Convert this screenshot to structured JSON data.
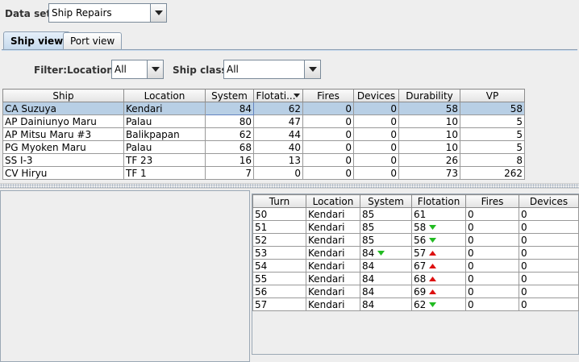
{
  "dataset": {
    "label": "Data set:",
    "value": "Ship Repairs"
  },
  "tabs": [
    {
      "label": "Ship view",
      "active": true
    },
    {
      "label": "Port view",
      "active": false
    }
  ],
  "filter": {
    "label": "Filter:",
    "location_label": "Location:",
    "location_value": "All",
    "shipclass_label": "Ship class:",
    "shipclass_value": "All"
  },
  "ships_table": {
    "columns": [
      "Ship",
      "Location",
      "System",
      "Flotati...",
      "Fires",
      "Devices",
      "Durability",
      "VP"
    ],
    "sorted_column": 3,
    "selected_row": 0,
    "rows": [
      [
        "CA Suzuya",
        "Kendari",
        "84",
        "62",
        "0",
        "0",
        "58",
        "58"
      ],
      [
        "AP Dainiunyo Maru",
        "Palau",
        "80",
        "47",
        "0",
        "0",
        "10",
        "5"
      ],
      [
        "AP Mitsu Maru #3",
        "Balikpapan",
        "62",
        "44",
        "0",
        "0",
        "10",
        "5"
      ],
      [
        "PG Myoken Maru",
        "Palau",
        "68",
        "40",
        "0",
        "0",
        "10",
        "5"
      ],
      [
        "SS I-3",
        "TF 23",
        "16",
        "13",
        "0",
        "0",
        "26",
        "8"
      ],
      [
        "CV Hiryu",
        "TF 1",
        "7",
        "0",
        "0",
        "0",
        "73",
        "262"
      ]
    ]
  },
  "history_table": {
    "columns": [
      "Turn",
      "Location",
      "System",
      "Flotation",
      "Fires",
      "Devices"
    ],
    "rows": [
      {
        "turn": "50",
        "location": "Kendari",
        "system": "85",
        "system_trend": "",
        "flotation": "61",
        "flotation_trend": "",
        "fires": "0",
        "devices": "0"
      },
      {
        "turn": "51",
        "location": "Kendari",
        "system": "85",
        "system_trend": "",
        "flotation": "58",
        "flotation_trend": "down",
        "fires": "0",
        "devices": "0"
      },
      {
        "turn": "52",
        "location": "Kendari",
        "system": "85",
        "system_trend": "",
        "flotation": "56",
        "flotation_trend": "down",
        "fires": "0",
        "devices": "0"
      },
      {
        "turn": "53",
        "location": "Kendari",
        "system": "84",
        "system_trend": "down",
        "flotation": "57",
        "flotation_trend": "up",
        "fires": "0",
        "devices": "0"
      },
      {
        "turn": "54",
        "location": "Kendari",
        "system": "84",
        "system_trend": "",
        "flotation": "67",
        "flotation_trend": "up",
        "fires": "0",
        "devices": "0"
      },
      {
        "turn": "55",
        "location": "Kendari",
        "system": "84",
        "system_trend": "",
        "flotation": "68",
        "flotation_trend": "up",
        "fires": "0",
        "devices": "0"
      },
      {
        "turn": "56",
        "location": "Kendari",
        "system": "84",
        "system_trend": "",
        "flotation": "69",
        "flotation_trend": "up",
        "fires": "0",
        "devices": "0"
      },
      {
        "turn": "57",
        "location": "Kendari",
        "system": "84",
        "system_trend": "",
        "flotation": "62",
        "flotation_trend": "down",
        "fires": "0",
        "devices": "0"
      }
    ]
  },
  "colors": {
    "trend_up": "#dd1111",
    "trend_down": "#22bb22",
    "selection": "#b8cfe5"
  }
}
